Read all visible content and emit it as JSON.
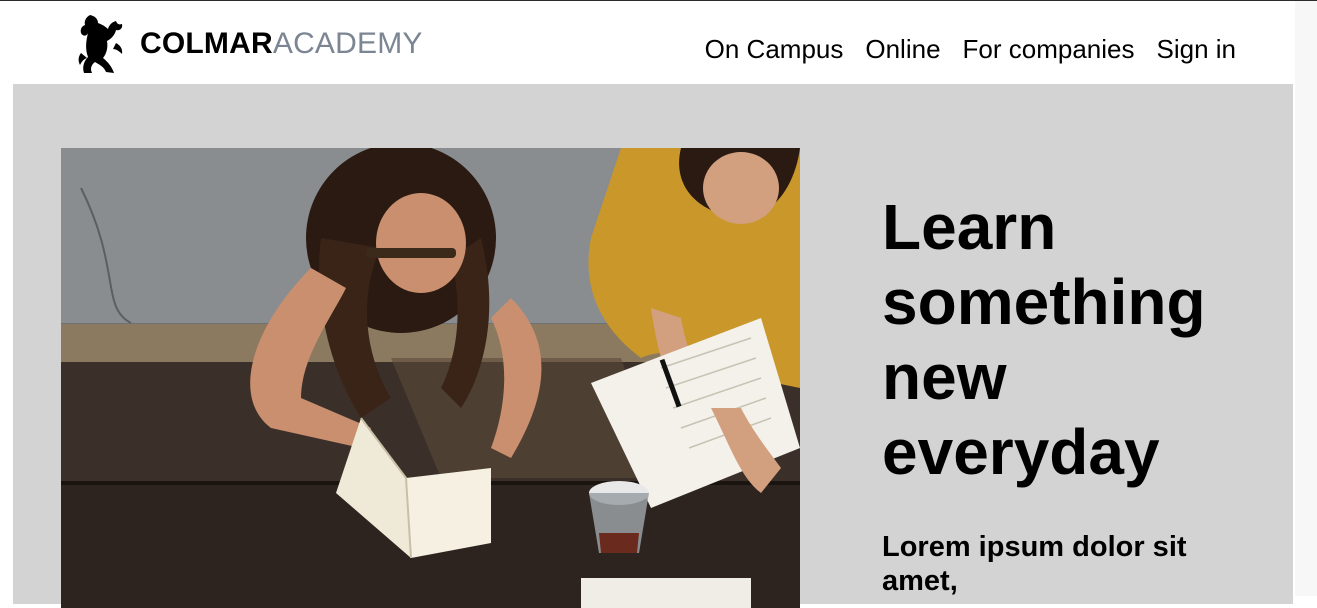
{
  "brand": {
    "name_strong": "COLMAR",
    "name_light": "ACADEMY",
    "logo_icon": "lion-rampant-icon"
  },
  "nav": {
    "items": [
      {
        "label": "On Campus"
      },
      {
        "label": "Online"
      },
      {
        "label": "For companies"
      },
      {
        "label": "Sign in"
      }
    ]
  },
  "hero": {
    "headline": "Learn something new everyday",
    "subheadline": "Lorem ipsum dolor sit amet,",
    "image": "two-students-studying-photo",
    "background_color": "#d3d3d3"
  },
  "colors": {
    "brand_light": "#7b8593",
    "text": "#000000"
  }
}
